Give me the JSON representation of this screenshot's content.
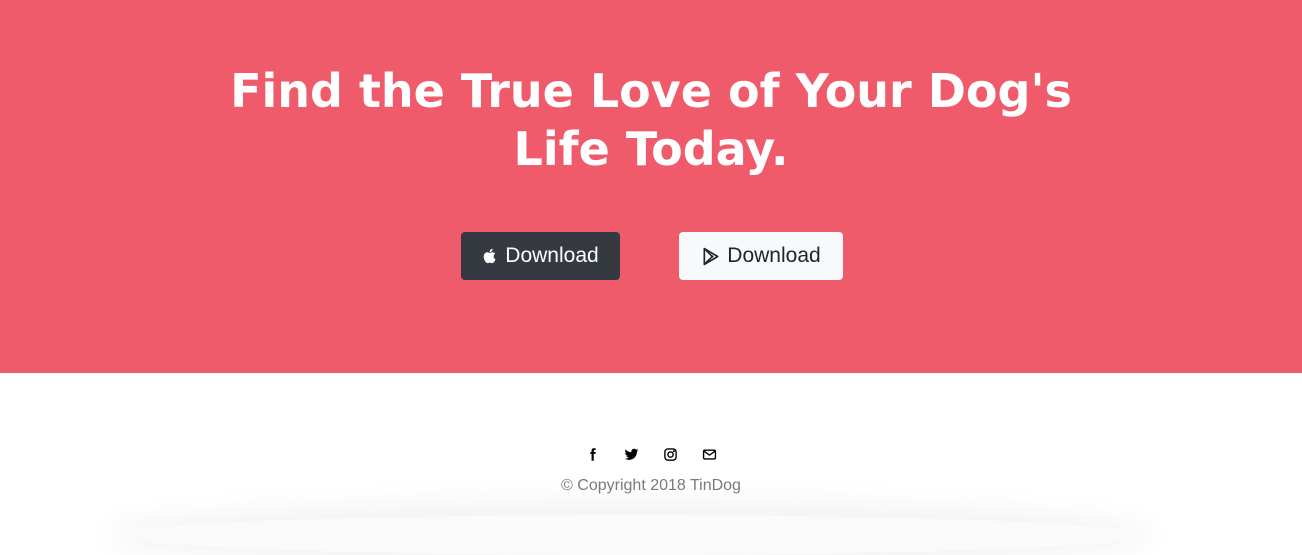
{
  "cta": {
    "heading_line1": "Find the True Love of Your Dog's",
    "heading_line2": "Life Today.",
    "background_color": "#ef5b6b",
    "buttons": [
      {
        "label": "Download",
        "icon": "apple-icon",
        "style": "dark"
      },
      {
        "label": "Download",
        "icon": "google-play-icon",
        "style": "light"
      }
    ]
  },
  "footer": {
    "social_icons": [
      "facebook-icon",
      "twitter-icon",
      "instagram-icon",
      "envelope-icon"
    ],
    "copyright": "© Copyright 2018 TinDog"
  }
}
